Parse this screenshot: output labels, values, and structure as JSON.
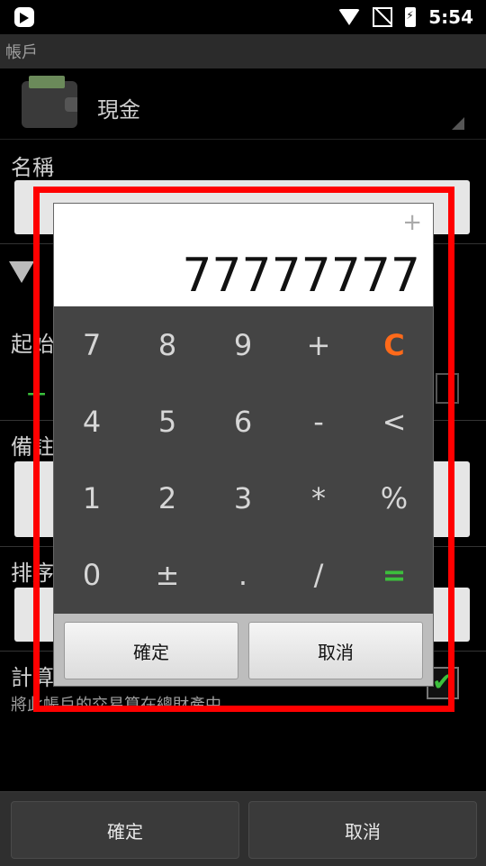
{
  "status": {
    "time": "5:54"
  },
  "appbar": {
    "title": "帳戶"
  },
  "account": {
    "selected": "現金"
  },
  "form": {
    "name_label": "名稱",
    "start_label": "起始",
    "note_label": "備註",
    "sort_label": "排序",
    "calc_label": "計算",
    "calc_hint": "將此帳戶的交易算在總財產中"
  },
  "calculator": {
    "display_value": "77777777",
    "op_indicator": "+",
    "keys": [
      [
        "7",
        "8",
        "9",
        "+",
        "C"
      ],
      [
        "4",
        "5",
        "6",
        "-",
        "<"
      ],
      [
        "1",
        "2",
        "3",
        "*",
        "%"
      ],
      [
        "0",
        "±",
        ".",
        "/",
        "="
      ]
    ],
    "confirm_label": "確定",
    "cancel_label": "取消"
  },
  "bottom": {
    "confirm_label": "確定",
    "cancel_label": "取消"
  }
}
